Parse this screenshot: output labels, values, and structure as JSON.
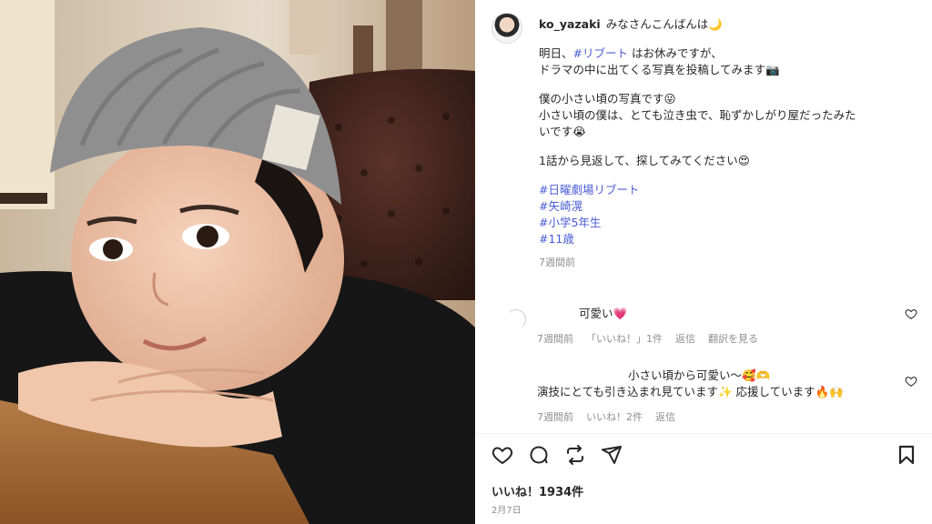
{
  "post": {
    "username": "ko_yazaki",
    "caption_first": "みなさんこんばんは🌙",
    "line1_prefix": "明日、",
    "line1_tag": "#リブート",
    "line1_suffix": " はお休みですが、",
    "line2": "ドラマの中に出てくる写真を投稿してみます📷",
    "line3": "僕の小さい頃の写真です😜",
    "line4": "小さい頃の僕は、とても泣き虫で、恥ずかしがり屋だったみた",
    "line5": "いです😭",
    "line6": "1話から見返して、探してみてください😍",
    "hashtags": [
      "#日曜劇場リブート",
      "#矢崎滉",
      "#小学5年生",
      "#11歳"
    ],
    "time": "7週間前"
  },
  "comments": [
    {
      "text": "可愛い💗",
      "time": "7週間前",
      "likes": "「いいね！」1件",
      "reply": "返信",
      "translate": "翻訳を見る"
    },
    {
      "text_line1": "小さい頃から可愛い〜🥰🫶",
      "text_line2": "演技にとても引き込まれ見ています✨ 応援しています🔥🙌",
      "time": "7週間前",
      "likes": "いいね！2件",
      "reply": "返信"
    }
  ],
  "footer": {
    "likes": "いいね！1934件",
    "date": "2月7日"
  },
  "icons": {
    "like": "heart-icon",
    "comment": "comment-icon",
    "share": "repost-icon",
    "send": "send-icon",
    "save": "bookmark-icon"
  },
  "colors": {
    "hashtag": "#4a5bd6",
    "muted": "#8e8e8e",
    "beanie": "#8f8f8f"
  }
}
